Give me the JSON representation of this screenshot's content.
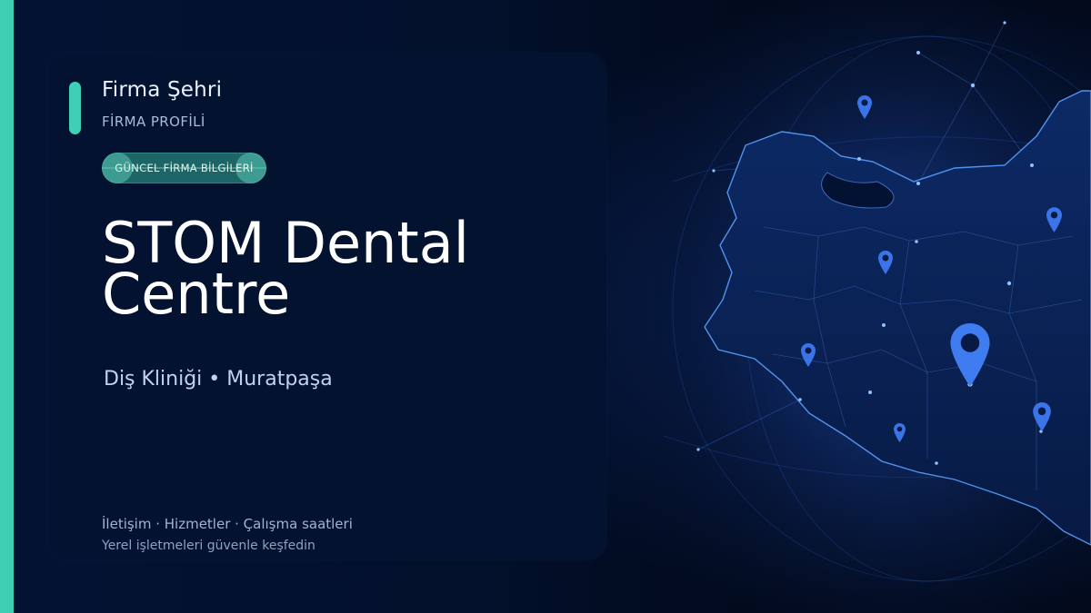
{
  "brand": {
    "name": "Firma Şehri",
    "section": "FİRMA PROFİLİ"
  },
  "badge": {
    "label": "GÜNCEL FİRMA BİLGİLERİ"
  },
  "business": {
    "name": "STOM Dental Centre",
    "category_location": "Diş Kliniği • Muratpaşa"
  },
  "footer": {
    "links": "İletişim · Hizmetler · Çalışma saatleri",
    "tagline": "Yerel işletmeleri güvenle keşfedin"
  },
  "colors": {
    "accent": "#3ecfb5",
    "background": "#020a1c",
    "card": "#031230",
    "map_glow": "#2f6bff"
  },
  "icons": [
    "map-pin-icon"
  ]
}
